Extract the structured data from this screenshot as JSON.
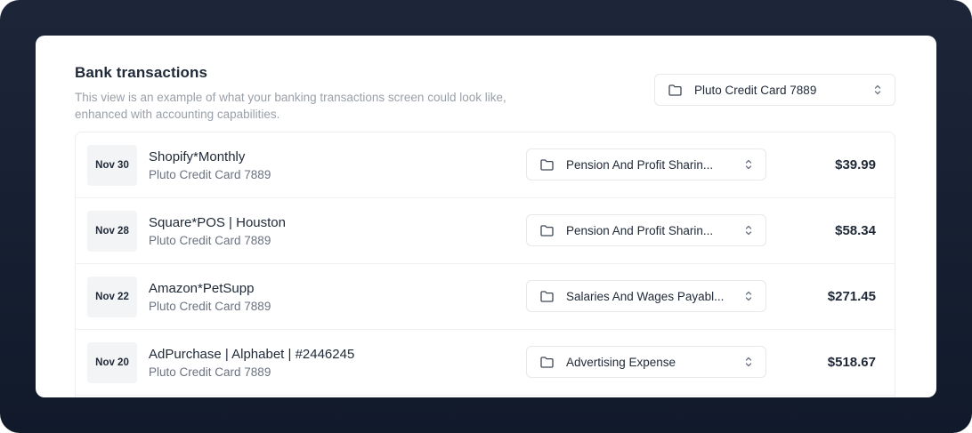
{
  "header": {
    "title": "Bank transactions",
    "description": "This view is an example of what your banking transactions screen could look like, enhanced with accounting capabilities."
  },
  "account_select": {
    "value": "Pluto Credit Card 7889",
    "icon": "folder-icon"
  },
  "transactions": [
    {
      "date": "Nov 30",
      "merchant": "Shopify*Monthly",
      "account": "Pluto Credit Card 7889",
      "category": "Pension And Profit Sharin...",
      "amount": "$39.99"
    },
    {
      "date": "Nov 28",
      "merchant": "Square*POS | Houston",
      "account": "Pluto Credit Card 7889",
      "category": "Pension And Profit Sharin...",
      "amount": "$58.34"
    },
    {
      "date": "Nov 22",
      "merchant": "Amazon*PetSupp",
      "account": "Pluto Credit Card 7889",
      "category": "Salaries And Wages Payabl...",
      "amount": "$271.45"
    },
    {
      "date": "Nov 20",
      "merchant": "AdPurchase | Alphabet | #2446245",
      "account": "Pluto Credit Card 7889",
      "category": "Advertising Expense",
      "amount": "$518.67"
    }
  ],
  "colors": {
    "frame": "#141d2e",
    "text": "#1f2937",
    "muted": "#6b7280",
    "date_bg": "#f3f4f6"
  }
}
